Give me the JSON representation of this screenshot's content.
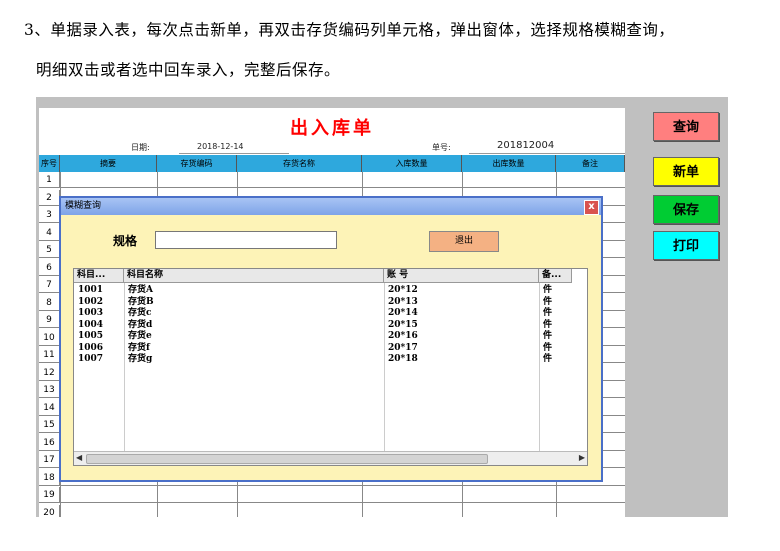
{
  "intro": {
    "line1": "3、单据录入表，每次点击新单，再双击存货编码列单元格，弹出窗体，选择规格模糊查询，",
    "line2": "明细双击或者选中回车录入，完整后保存。"
  },
  "sheet": {
    "title": "出入库单",
    "date_label": "日期:",
    "date_value": "2018-12-14",
    "no_label": "单号:",
    "no_value": "201812004",
    "headers": [
      "序号",
      "摘要",
      "存货编码",
      "存货名称",
      "入库数量",
      "出库数量",
      "备注"
    ],
    "row_numbers": [
      "1",
      "2",
      "3",
      "4",
      "5",
      "6",
      "7",
      "8",
      "9",
      "10",
      "11",
      "12",
      "13",
      "14",
      "15",
      "16",
      "17",
      "18",
      "19",
      "20"
    ]
  },
  "buttons": {
    "query": "查询",
    "new": "新单",
    "save": "保存",
    "print": "打印"
  },
  "colors": {
    "query_bg": "#ff7f7f",
    "new_bg": "#ffff00",
    "save_bg": "#00cc33",
    "print_bg": "#00ffff",
    "header_bg": "#2ea8dd"
  },
  "dialog": {
    "title": "模糊查询",
    "close": "x",
    "spec_label": "规格",
    "spec_value": "",
    "exit_label": "退出",
    "columns": [
      "科目...",
      "科目名称",
      "账    号",
      "备..."
    ],
    "rows": [
      [
        "1001",
        "存货A",
        "20*12",
        "件"
      ],
      [
        "1002",
        "存货B",
        "20*13",
        "件"
      ],
      [
        "1003",
        "存货c",
        "20*14",
        "件"
      ],
      [
        "1004",
        "存货d",
        "20*15",
        "件"
      ],
      [
        "1005",
        "存货e",
        "20*16",
        "件"
      ],
      [
        "1006",
        "存货f",
        "20*17",
        "件"
      ],
      [
        "1007",
        "存货g",
        "20*18",
        "件"
      ]
    ]
  }
}
